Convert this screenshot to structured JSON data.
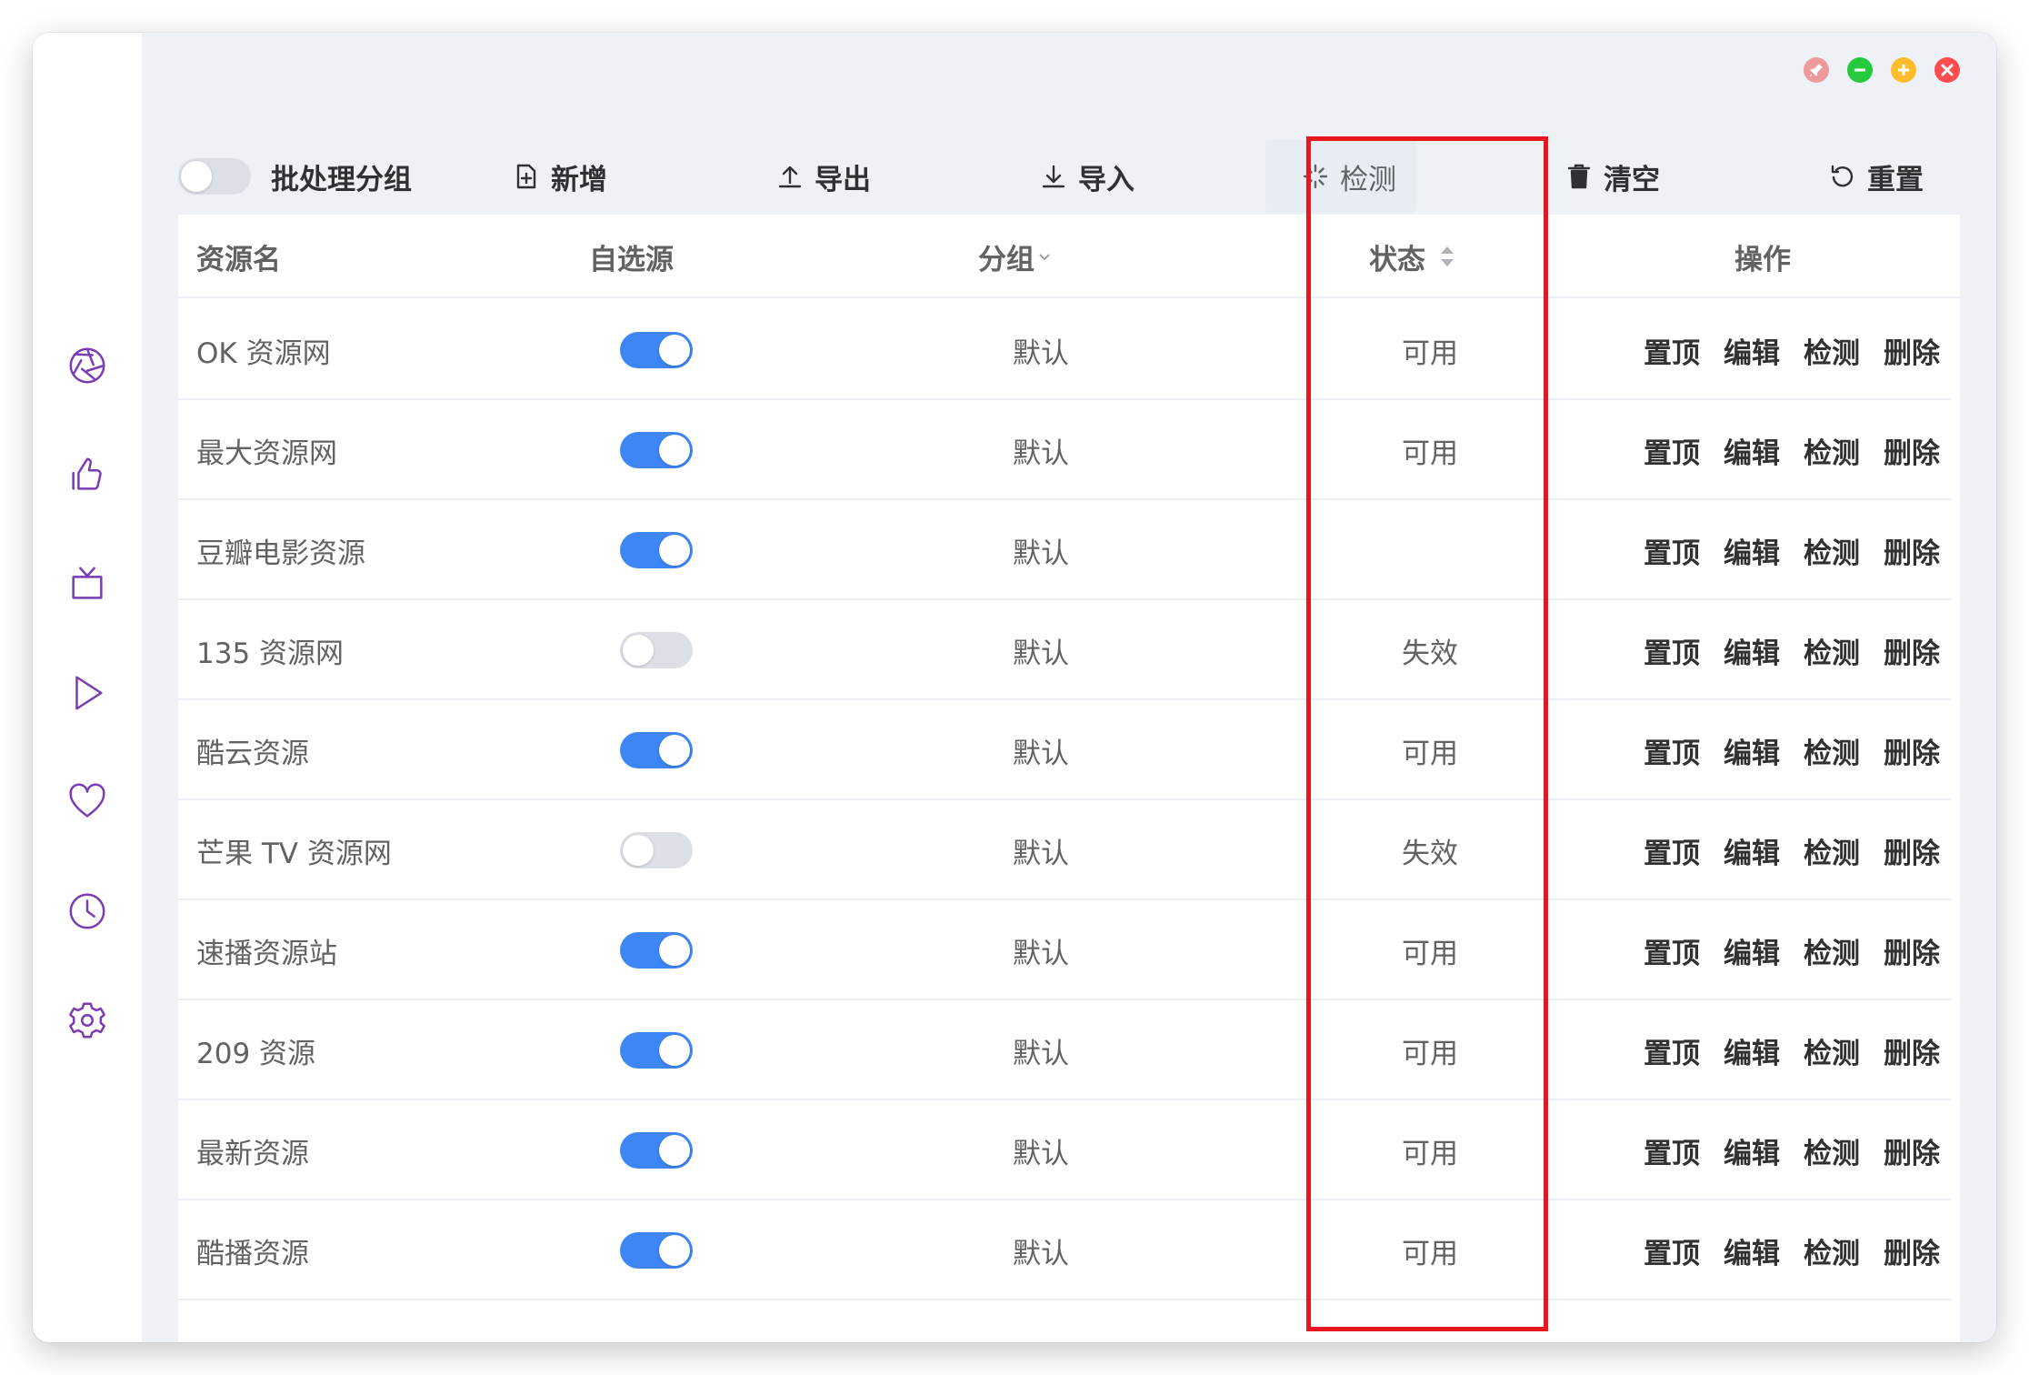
{
  "toolbar": {
    "batch_group_label": "批处理分组",
    "add_label": "新增",
    "export_label": "导出",
    "import_label": "导入",
    "detect_label": "检测",
    "clear_label": "清空",
    "reset_label": "重置"
  },
  "columns": {
    "name": "资源名",
    "custom": "自选源",
    "group": "分组",
    "status": "状态",
    "actions": "操作"
  },
  "row_actions": {
    "top": "置顶",
    "edit": "编辑",
    "check": "检测",
    "delete": "删除"
  },
  "rows": [
    {
      "name": "OK 资源网",
      "enabled": true,
      "group": "默认",
      "status": "可用"
    },
    {
      "name": "最大资源网",
      "enabled": true,
      "group": "默认",
      "status": "可用"
    },
    {
      "name": "豆瓣电影资源",
      "enabled": true,
      "group": "默认",
      "status": ""
    },
    {
      "name": "135 资源网",
      "enabled": false,
      "group": "默认",
      "status": "失效"
    },
    {
      "name": "酷云资源",
      "enabled": true,
      "group": "默认",
      "status": "可用"
    },
    {
      "name": "芒果 TV 资源网",
      "enabled": false,
      "group": "默认",
      "status": "失效"
    },
    {
      "name": "速播资源站",
      "enabled": true,
      "group": "默认",
      "status": "可用"
    },
    {
      "name": "209 资源",
      "enabled": true,
      "group": "默认",
      "status": "可用"
    },
    {
      "name": "最新资源",
      "enabled": true,
      "group": "默认",
      "status": "可用"
    },
    {
      "name": "酷播资源",
      "enabled": true,
      "group": "默认",
      "status": "可用"
    }
  ],
  "sidebar_icons": [
    "aperture-icon",
    "thumbs-up-icon",
    "tv-icon",
    "play-icon",
    "heart-icon",
    "clock-icon",
    "settings-icon"
  ],
  "colors": {
    "accent": "#7b3bb5",
    "switch_on": "#3e86f5",
    "highlight": "#e8161e",
    "pin": "#ef9a9a",
    "minimize": "#27c93f",
    "maximize": "#ffbd2e",
    "close": "#ff4d4f"
  }
}
